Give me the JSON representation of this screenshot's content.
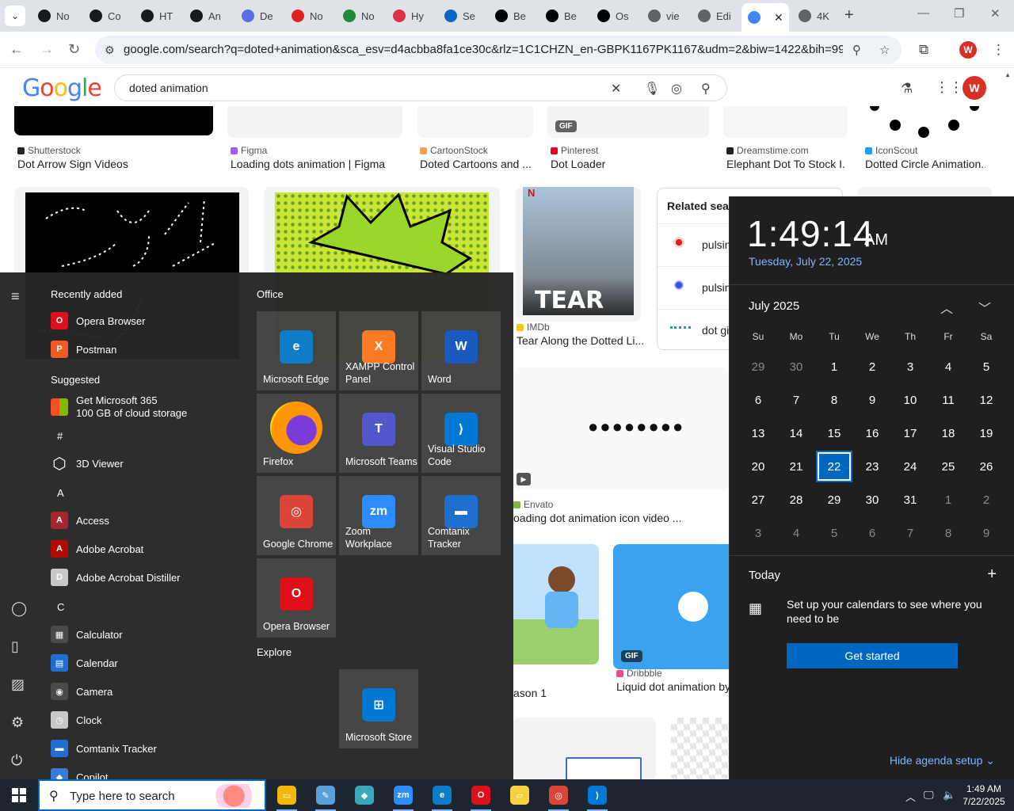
{
  "browser": {
    "tabs": [
      {
        "label": "No",
        "color": "#1a1a1a"
      },
      {
        "label": "Co",
        "color": "#1a1a1a"
      },
      {
        "label": "HT",
        "color": "#1a1a1a"
      },
      {
        "label": "An",
        "color": "#1a1a1a"
      },
      {
        "label": "De",
        "color": "#5b6ee1"
      },
      {
        "label": "No",
        "color": "#e02020"
      },
      {
        "label": "No",
        "color": "#1f8a3b"
      },
      {
        "label": "Hy",
        "color": "#e0314a"
      },
      {
        "label": "Se",
        "color": "#0a66c2"
      },
      {
        "label": "Be",
        "color": "#000000"
      },
      {
        "label": "Be",
        "color": "#000000"
      },
      {
        "label": "Os",
        "color": "#000000"
      },
      {
        "label": "vie",
        "color": "#5f6368"
      },
      {
        "label": "Edi",
        "color": "#5f6368"
      },
      {
        "label": "",
        "color": "#4285f4"
      },
      {
        "label": "4K",
        "color": "#5f6368"
      }
    ],
    "url": "google.com/search?q=doted+animation&sca_esv=d4acbba8fa1ce30c&rlz=1C1CHZN_en-GBPK1167PK1167&udm=2&biw=1422&bih=996&sxsrf...",
    "profile_initial": "W"
  },
  "google": {
    "logo": "Google",
    "query": "doted animation",
    "profile_initial": "W"
  },
  "results_row1": [
    {
      "source": "Shutterstock",
      "title": "Dot Arrow Sign Videos",
      "fav": "#222"
    },
    {
      "source": "Figma",
      "title": "Loading dots animation | Figma",
      "fav": "#a259ff"
    },
    {
      "source": "CartoonStock",
      "title": "Doted Cartoons and ...",
      "fav": "#f4a259"
    },
    {
      "source": "Pinterest",
      "title": "Dot Loader",
      "fav": "#e60023"
    },
    {
      "source": "Dreamstime.com",
      "title": "Elephant Dot To Stock I...",
      "fav": "#222"
    },
    {
      "source": "IconScout",
      "title": "Dotted Circle Animation...",
      "fav": "#18a0fb"
    }
  ],
  "results_row2": [
    {
      "source": "IMDb",
      "title": "Tear Along the Dotted Li...",
      "fav": "#f5c518"
    },
    {
      "source": "Envato",
      "title": "oading dot animation icon video ...",
      "fav": "#82b541"
    }
  ],
  "results_row3": [
    {
      "title": "ason 1"
    },
    {
      "source": "Dribbble",
      "title": "Liquid dot animation by A",
      "fav": "#ea4c89"
    }
  ],
  "badges": {
    "gif": "GIF"
  },
  "imdb_poster_text": "TEAR",
  "related": {
    "title": "Related sear",
    "items": [
      "pulsin",
      "pulsin",
      "dot gi"
    ]
  },
  "start_menu": {
    "recently_added_label": "Recently added",
    "recent": [
      {
        "label": "Opera Browser",
        "color": "#e0101a",
        "glyph": "O"
      },
      {
        "label": "Postman",
        "color": "#ef5b25",
        "glyph": "P"
      }
    ],
    "suggested_label": "Suggested",
    "suggested": [
      {
        "line1": "Get Microsoft 365",
        "line2": "100 GB of cloud storage"
      }
    ],
    "hash_label": "#",
    "hash_items": [
      {
        "label": "3D Viewer",
        "color": "transparent",
        "glyph": "⬡"
      }
    ],
    "letter_a": "A",
    "a_items": [
      {
        "label": "Access",
        "color": "#a4262c",
        "glyph": "A"
      },
      {
        "label": "Adobe Acrobat",
        "color": "#b30b00",
        "glyph": "A"
      },
      {
        "label": "Adobe Acrobat Distiller",
        "color": "#c8c8c8",
        "glyph": "D"
      }
    ],
    "letter_c": "C",
    "c_items": [
      {
        "label": "Calculator",
        "color": "#4a4a4a",
        "glyph": "▦"
      },
      {
        "label": "Calendar",
        "color": "#1f6fd1",
        "glyph": "▤"
      },
      {
        "label": "Camera",
        "color": "#4a4a4a",
        "glyph": "◉"
      },
      {
        "label": "Clock",
        "color": "#c8c8c8",
        "glyph": "◷"
      },
      {
        "label": "Comtanix Tracker",
        "color": "#1f6fd1",
        "glyph": "▬"
      },
      {
        "label": "Copilot",
        "color": "#3a7bd5",
        "glyph": "◆"
      }
    ],
    "office_label": "Office",
    "tiles": [
      {
        "label": "Microsoft Edge",
        "color": "#0f7cc7",
        "glyph": "e"
      },
      {
        "label": "XAMPP Control Panel",
        "color": "#fb7a24",
        "glyph": "X"
      },
      {
        "label": "Word",
        "color": "#185abd",
        "glyph": "W"
      },
      {
        "label": "Firefox",
        "color": "#ff7139",
        "glyph": "F"
      },
      {
        "label": "Microsoft Teams",
        "color": "#5059c9",
        "glyph": "T"
      },
      {
        "label": "Visual Studio Code",
        "color": "#0078d4",
        "glyph": "⟩"
      },
      {
        "label": "Google Chrome",
        "color": "#db4437",
        "glyph": "◎"
      },
      {
        "label": "Zoom Workplace",
        "color": "#2d8cff",
        "glyph": "zm"
      },
      {
        "label": "Comtanix Tracker",
        "color": "#1f6fd1",
        "glyph": "▬"
      },
      {
        "label": "Opera Browser",
        "color": "#e0101a",
        "glyph": "O"
      }
    ],
    "explore_label": "Explore",
    "explore_tiles": [
      {
        "label": "Microsoft Store",
        "color": "#0078d4",
        "glyph": "⊞"
      }
    ]
  },
  "calendar": {
    "time": "1:49:14",
    "ampm": "AM",
    "date": "Tuesday, July 22, 2025",
    "month": "July 2025",
    "dow": [
      "Su",
      "Mo",
      "Tu",
      "We",
      "Th",
      "Fr",
      "Sa"
    ],
    "weeks": [
      [
        "29",
        "30",
        "1",
        "2",
        "3",
        "4",
        "5"
      ],
      [
        "6",
        "7",
        "8",
        "9",
        "10",
        "11",
        "12"
      ],
      [
        "13",
        "14",
        "15",
        "16",
        "17",
        "18",
        "19"
      ],
      [
        "20",
        "21",
        "22",
        "23",
        "24",
        "25",
        "26"
      ],
      [
        "27",
        "28",
        "29",
        "30",
        "31",
        "1",
        "2"
      ],
      [
        "3",
        "4",
        "5",
        "6",
        "7",
        "8",
        "9"
      ]
    ],
    "today_label": "Today",
    "agenda_text": "Set up your calendars to see where you need to be",
    "get_started": "Get started",
    "hide_agenda": "Hide agenda setup"
  },
  "taskbar": {
    "search_placeholder": "Type here to search",
    "apps": [
      {
        "name": "file-explorer",
        "color": "#f2b90c",
        "glyph": "▭"
      },
      {
        "name": "app-2",
        "color": "#5aa0d8",
        "glyph": "✎"
      },
      {
        "name": "app-3",
        "color": "#3aa7b8",
        "glyph": "◆"
      },
      {
        "name": "zoom",
        "color": "#2d8cff",
        "glyph": "zm"
      },
      {
        "name": "edge",
        "color": "#0f7cc7",
        "glyph": "e"
      },
      {
        "name": "opera",
        "color": "#e0101a",
        "glyph": "O"
      },
      {
        "name": "sticky-notes",
        "color": "#f7d23e",
        "glyph": "▱"
      },
      {
        "name": "chrome",
        "color": "#db4437",
        "glyph": "◎"
      },
      {
        "name": "vscode",
        "color": "#0078d4",
        "glyph": "⟩"
      }
    ],
    "time": "1:49 AM",
    "date": "7/22/2025"
  }
}
